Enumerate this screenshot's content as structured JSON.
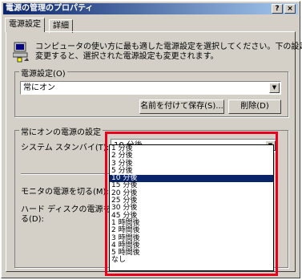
{
  "window": {
    "title": "電源の管理のプロパティ",
    "help_button": "?",
    "close_button": "×"
  },
  "tabs": [
    {
      "label": "電源設定"
    },
    {
      "label": "詳細"
    }
  ],
  "description": {
    "line1": "コンピュータの使い方に最も適した電源設定を選択してください。下の設定を",
    "line2": "変更すると、選択された電源設定も変更されます。"
  },
  "power_schemes": {
    "group_label": "電源設定(O)",
    "selected": "常にオン",
    "save_as_button": "名前を付けて保存(S)...",
    "delete_button": "削除(D)"
  },
  "settings_group": {
    "label": "常にオンの電源の設定",
    "standby_label": "システム スタンバイ(T):",
    "standby_value": "10 分後",
    "monitor_label": "モニタの電源を切る(M):",
    "hdd_label_line1": "ハード ディスクの電源を切",
    "hdd_label_line2": "る(D):"
  },
  "dropdown": {
    "options": [
      "1 分後",
      "2 分後",
      "3 分後",
      "5 分後",
      "10 分後",
      "15 分後",
      "20 分後",
      "25 分後",
      "30 分後",
      "45 分後",
      "1 時間後",
      "2 時間後",
      "3 時間後",
      "4 時間後",
      "5 時間後",
      "なし"
    ],
    "selected": "10 分後"
  },
  "colors": {
    "highlight_border": "#e8001c",
    "selection": "#0a246a",
    "face": "#d4d0c8"
  }
}
